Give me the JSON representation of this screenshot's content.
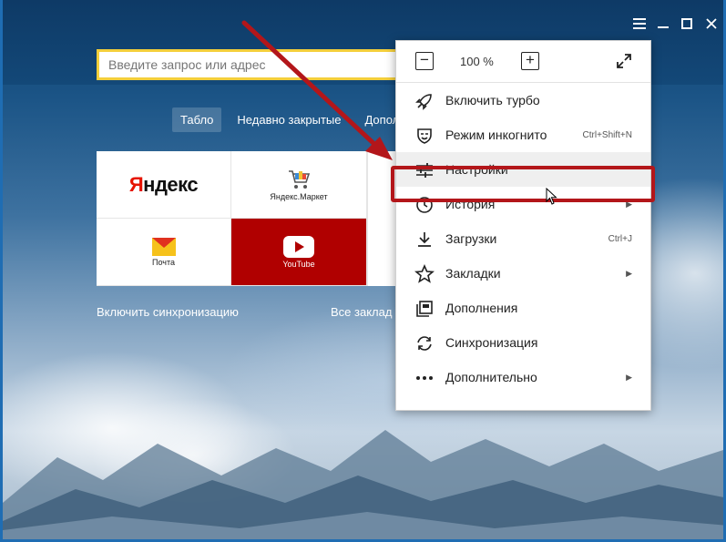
{
  "window": {
    "menu_icon": "hamburger-icon",
    "minimize_icon": "minimize-icon",
    "maximize_icon": "maximize-icon",
    "close_icon": "close-icon"
  },
  "search": {
    "placeholder": "Введите запрос или адрес"
  },
  "tabs": [
    {
      "label": "Табло",
      "active": true
    },
    {
      "label": "Недавно закрытые"
    },
    {
      "label": "Допол"
    }
  ],
  "tiles": [
    {
      "logo": "Яндекс",
      "caption": ""
    },
    {
      "caption": "Яндекс.Маркет",
      "icon": "cart-icon"
    },
    {
      "caption": "Почта",
      "icon": "mail-icon"
    },
    {
      "caption": "YouTube",
      "icon": "play-icon"
    }
  ],
  "below": {
    "sync_label": "Включить синхронизацию",
    "bookmarks_label": "Все заклад"
  },
  "menu": {
    "zoom": {
      "minus": "−",
      "value": "100 %",
      "plus": "+"
    },
    "items": [
      {
        "label": "Включить турбо",
        "icon": "rocket-icon",
        "shortcut": ""
      },
      {
        "label": "Режим инкогнито",
        "icon": "incognito-icon",
        "shortcut": "Ctrl+Shift+N"
      },
      {
        "label": "Настройки",
        "icon": "settings-sliders-icon",
        "shortcut": ""
      },
      {
        "label": "История",
        "icon": "clock-icon",
        "shortcut": "",
        "submenu": true
      },
      {
        "label": "Загрузки",
        "icon": "download-icon",
        "shortcut": "Ctrl+J"
      },
      {
        "label": "Закладки",
        "icon": "star-icon",
        "shortcut": "",
        "submenu": true
      },
      {
        "label": "Дополнения",
        "icon": "extensions-icon",
        "shortcut": ""
      },
      {
        "label": "Синхронизация",
        "icon": "sync-icon",
        "shortcut": ""
      },
      {
        "label": "Дополнительно",
        "icon": "more-icon",
        "shortcut": "",
        "submenu": true
      }
    ],
    "submenu_arrow": "▶"
  },
  "colors": {
    "highlight_border": "#b3161a",
    "search_border": "#f4cf3b",
    "youtube_tile": "#b00000"
  }
}
